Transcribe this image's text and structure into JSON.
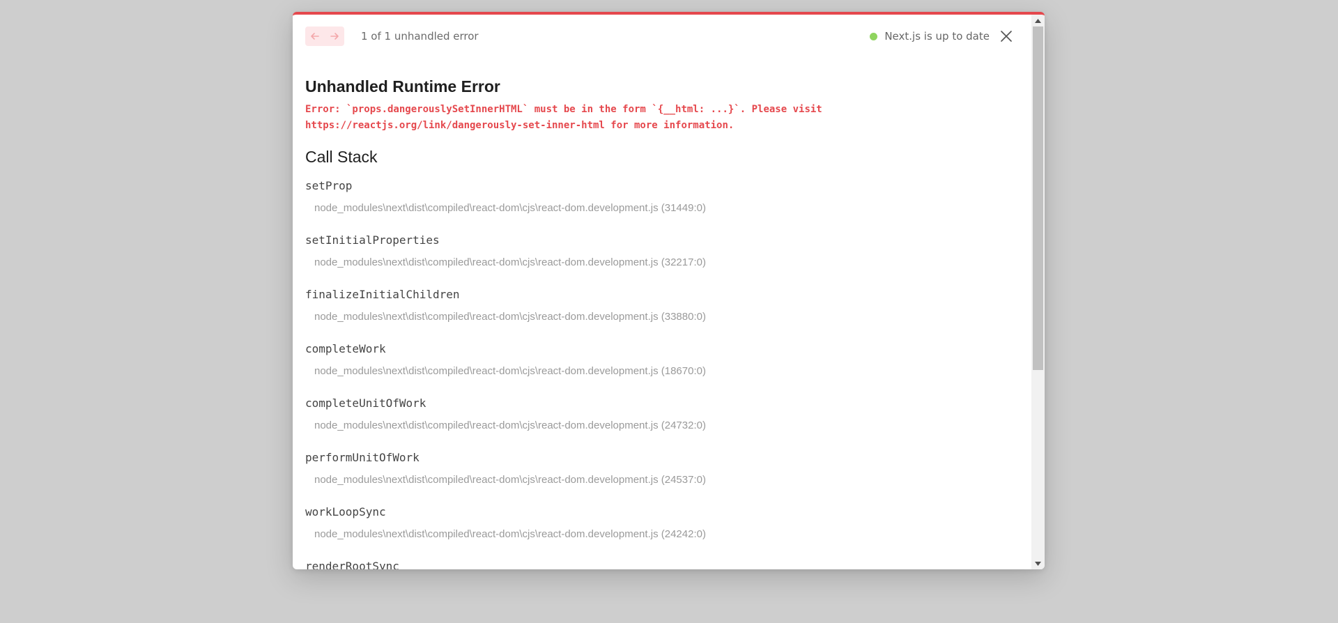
{
  "header": {
    "error_count": "1 of 1 unhandled error",
    "status_text": "Next.js is up to date",
    "status_color": "#8fd45f",
    "prev_icon": "arrow-left-icon",
    "next_icon": "arrow-right-icon",
    "close_icon": "close-icon"
  },
  "error": {
    "title": "Unhandled Runtime Error",
    "message": "Error: `props.dangerouslySetInnerHTML` must be in the form `{__html: ...}`. Please visit\nhttps://reactjs.org/link/dangerously-set-inner-html for more information.",
    "accent_color": "#e5484d"
  },
  "call_stack": {
    "title": "Call Stack",
    "frames": [
      {
        "fn": "setProp",
        "file": "node_modules\\next\\dist\\compiled\\react-dom\\cjs\\react-dom.development.js (31449:0)"
      },
      {
        "fn": "setInitialProperties",
        "file": "node_modules\\next\\dist\\compiled\\react-dom\\cjs\\react-dom.development.js (32217:0)"
      },
      {
        "fn": "finalizeInitialChildren",
        "file": "node_modules\\next\\dist\\compiled\\react-dom\\cjs\\react-dom.development.js (33880:0)"
      },
      {
        "fn": "completeWork",
        "file": "node_modules\\next\\dist\\compiled\\react-dom\\cjs\\react-dom.development.js (18670:0)"
      },
      {
        "fn": "completeUnitOfWork",
        "file": "node_modules\\next\\dist\\compiled\\react-dom\\cjs\\react-dom.development.js (24732:0)"
      },
      {
        "fn": "performUnitOfWork",
        "file": "node_modules\\next\\dist\\compiled\\react-dom\\cjs\\react-dom.development.js (24537:0)"
      },
      {
        "fn": "workLoopSync",
        "file": "node_modules\\next\\dist\\compiled\\react-dom\\cjs\\react-dom.development.js (24242:0)"
      },
      {
        "fn": "renderRootSync",
        "file": ""
      }
    ]
  }
}
